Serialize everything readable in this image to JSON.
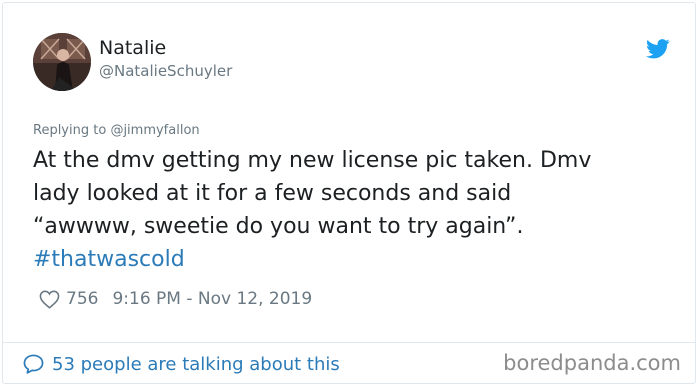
{
  "author": {
    "name": "Natalie",
    "handle": "@NatalieSchuyler"
  },
  "reply": {
    "prefix": "Replying to ",
    "mention": "@jimmyfallon"
  },
  "tweet": {
    "lines": [
      "At the dmv getting my new license pic taken. Dmv",
      "lady looked at it for a few seconds and said",
      "“awwww, sweetie do you want to try again”."
    ],
    "hashtag": "#thatwascold"
  },
  "meta": {
    "likes": "756",
    "timestamp": "9:16 PM - Nov 12, 2019"
  },
  "footer": {
    "conversation": "53 people are talking about this"
  },
  "watermark": "boredpanda.com",
  "icons": {
    "brand": "twitter-bird-icon",
    "like": "heart-icon",
    "conversation": "speech-bubble-icon"
  },
  "colors": {
    "link": "#2b7bb9",
    "text": "#1c2022",
    "muted": "#697882",
    "twitter_blue": "#1da1f2",
    "border": "#e1e8ed"
  }
}
